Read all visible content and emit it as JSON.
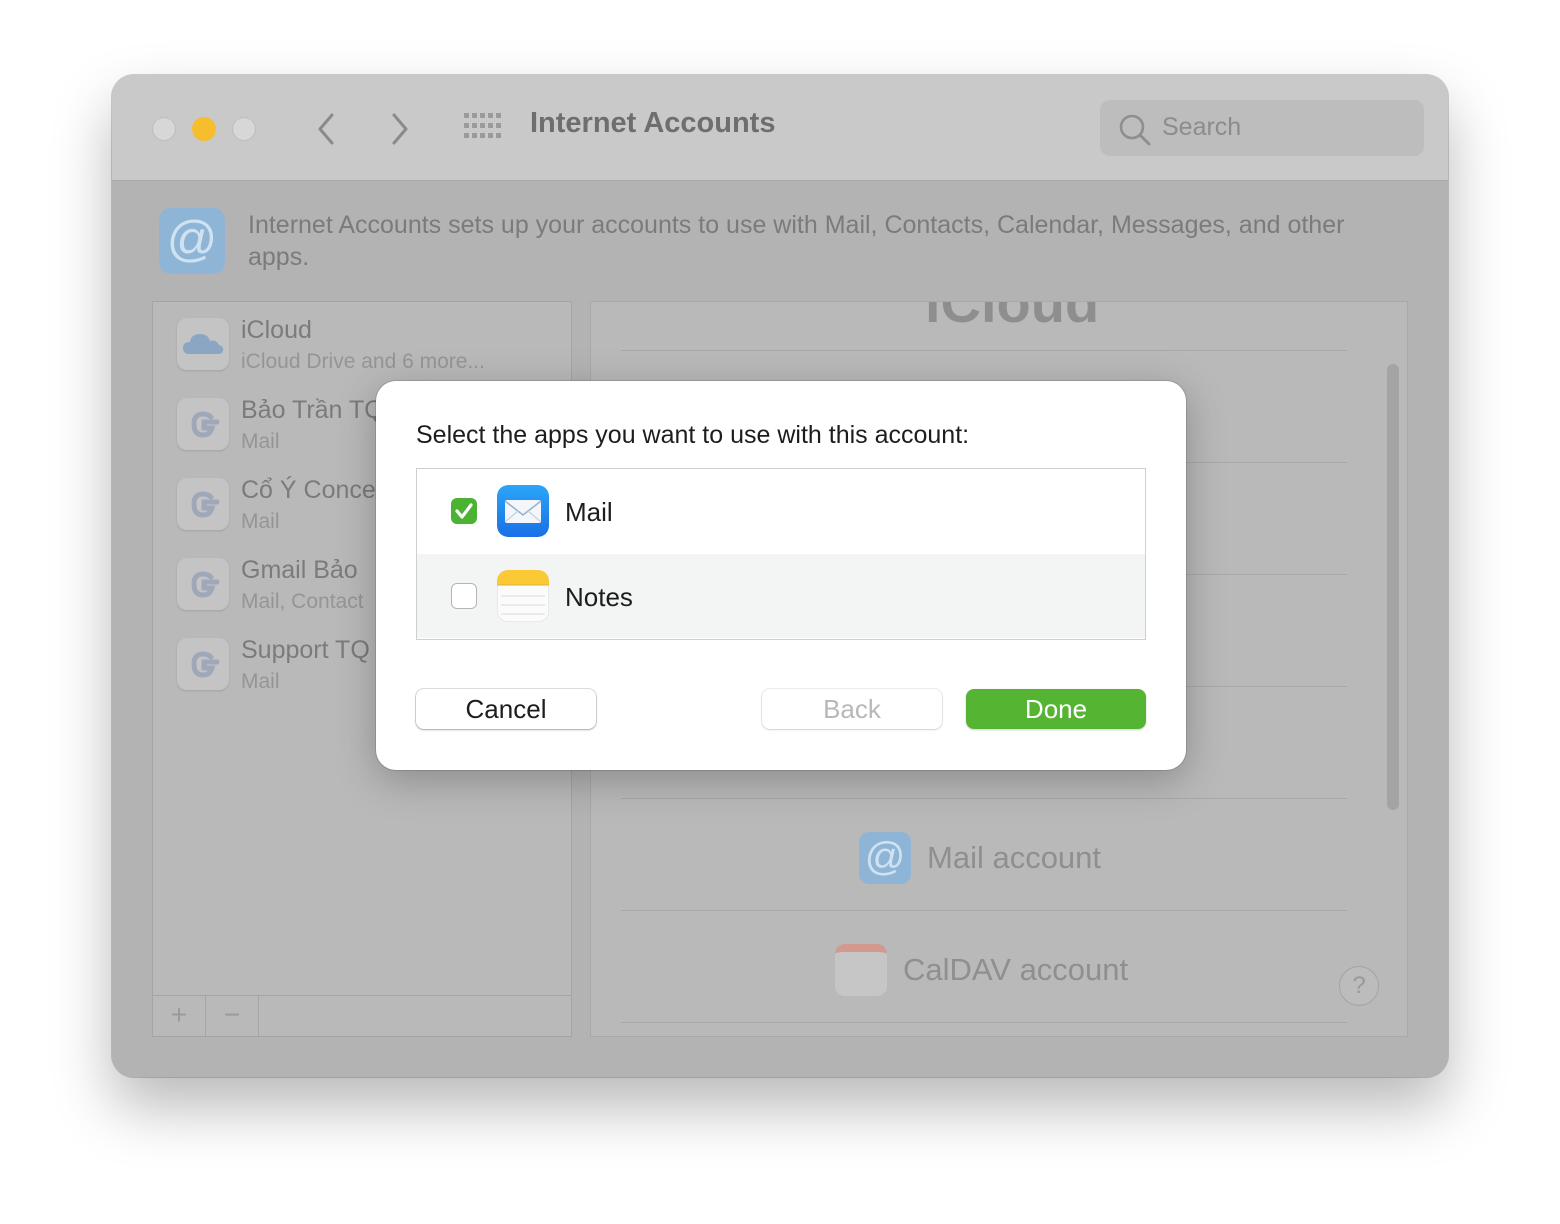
{
  "window": {
    "title": "Internet Accounts",
    "search_placeholder": "Search"
  },
  "header": {
    "description": "Internet Accounts sets up your accounts to use with Mail, Contacts, Calendar, Messages, and other apps."
  },
  "accounts": [
    {
      "name": "iCloud",
      "detail": "iCloud Drive and 6 more...",
      "icon": "icloud-icon"
    },
    {
      "name": "Bảo Trần TQ",
      "detail": "Mail",
      "icon": "google-icon"
    },
    {
      "name": "Cổ Ý Conce",
      "detail": "Mail",
      "icon": "google-icon"
    },
    {
      "name": "Gmail Bảo",
      "detail": "Mail, Contact",
      "icon": "google-icon"
    },
    {
      "name": "Support TQ",
      "detail": "Mail",
      "icon": "google-icon"
    }
  ],
  "list_footer": {
    "add": "+",
    "remove": "−"
  },
  "providers": {
    "top_partial": "iCloud",
    "mail_account": "Mail account",
    "caldav_account": "CalDAV account",
    "help": "?"
  },
  "dialog": {
    "prompt": "Select the apps you want to use with this account:",
    "apps": [
      {
        "label": "Mail",
        "checked": true,
        "icon": "mail-app-icon"
      },
      {
        "label": "Notes",
        "checked": false,
        "icon": "notes-app-icon"
      }
    ],
    "buttons": {
      "cancel": "Cancel",
      "back": "Back",
      "done": "Done"
    }
  },
  "colors": {
    "done_green": "#55b533",
    "checkbox_green": "#4cb233",
    "minimize_yellow": "#f6bd2c"
  }
}
